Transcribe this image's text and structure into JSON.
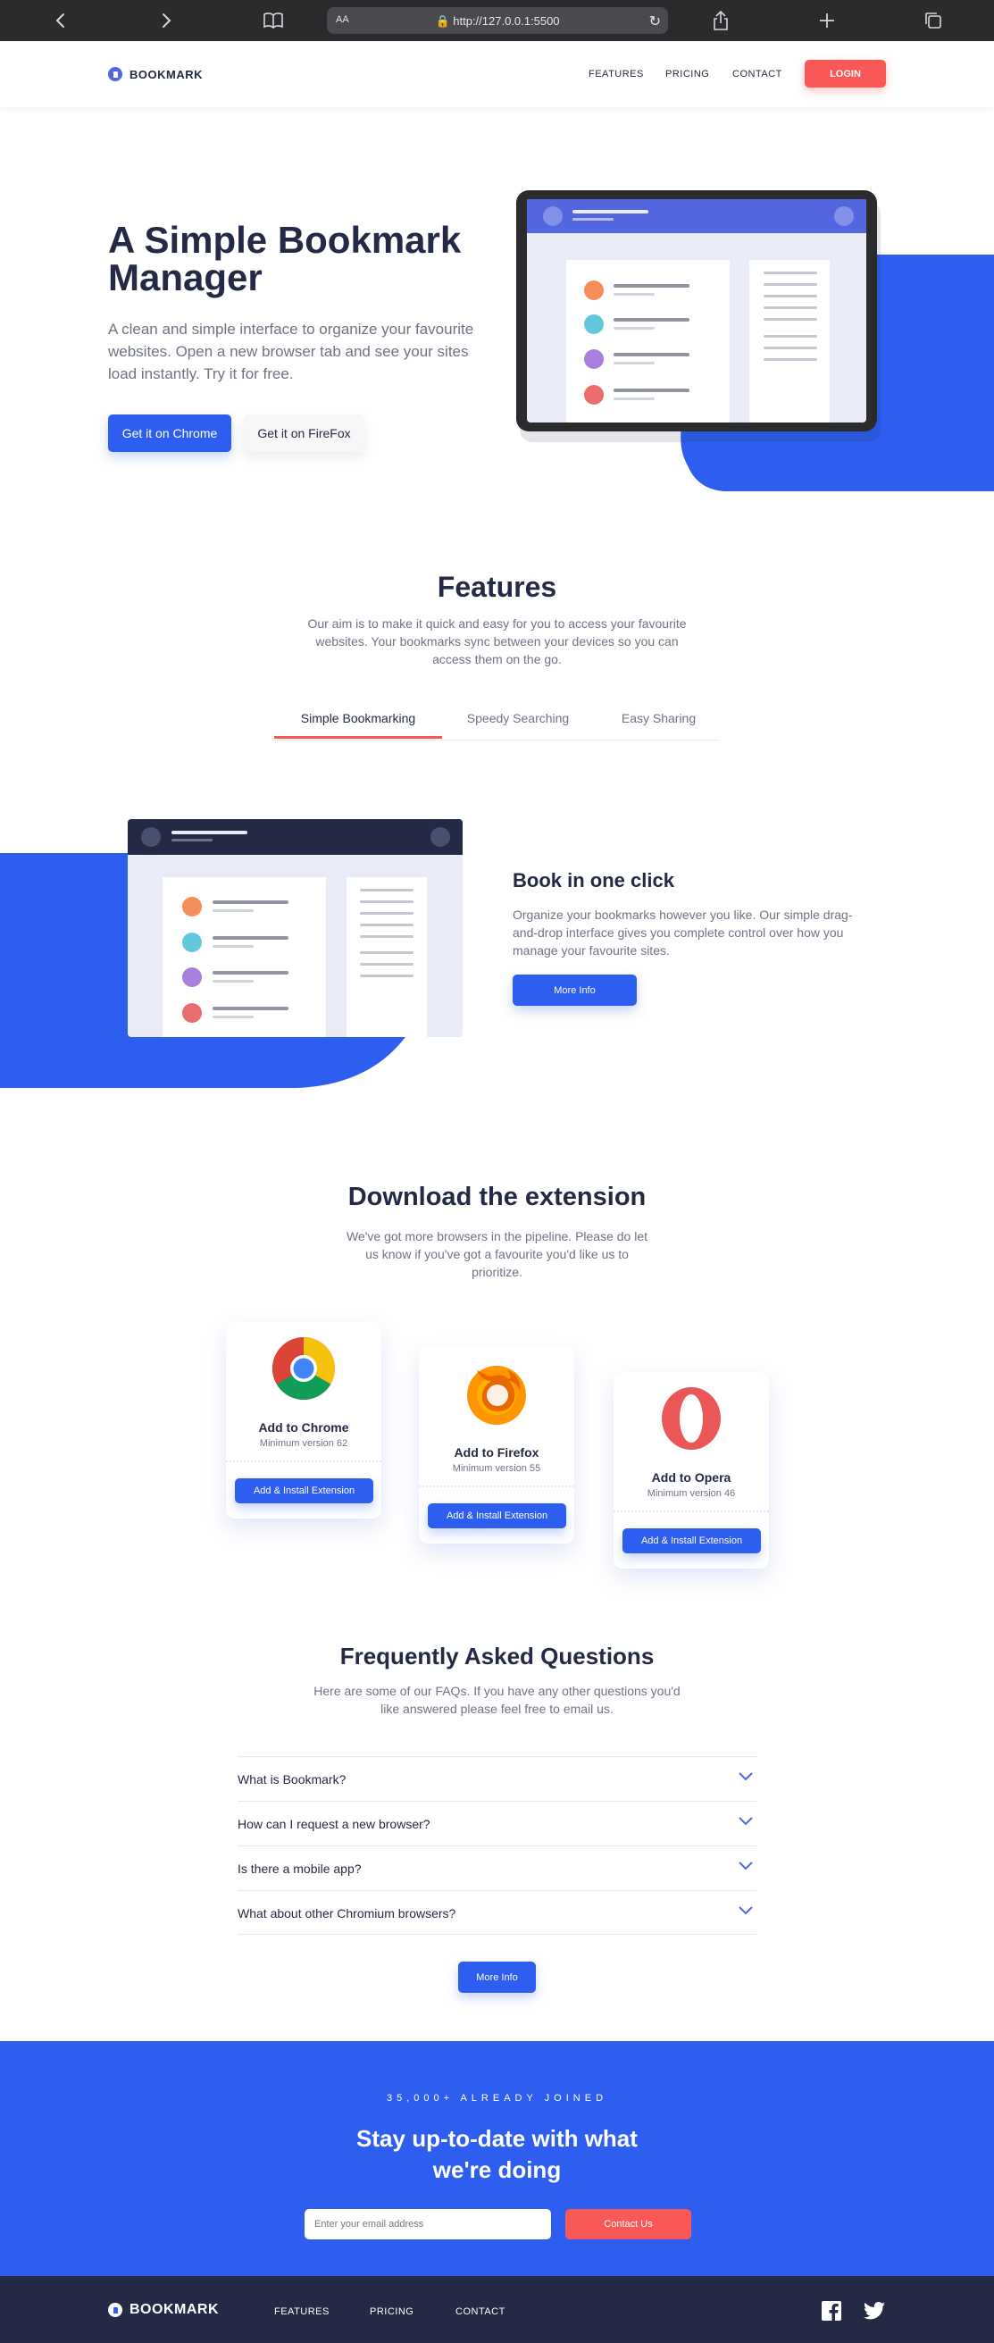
{
  "browser": {
    "url": "http://127.0.0.1:5500",
    "text_size_label": "AA"
  },
  "header": {
    "logo_text": "BOOKMARK",
    "nav": [
      "FEATURES",
      "PRICING",
      "CONTACT"
    ],
    "login": "LOGIN"
  },
  "hero": {
    "title": "A Simple Bookmark Manager",
    "text": "A clean and simple interface to organize your favourite websites. Open a new browser tab and see your sites load instantly. Try it for free.",
    "btn_chrome": "Get it on Chrome",
    "btn_firefox": "Get it on FireFox"
  },
  "features": {
    "title": "Features",
    "text": "Our aim is to make it quick and easy for you to access your favourite websites. Your bookmarks sync between your devices so you can access them on the go.",
    "tabs": [
      "Simple Bookmarking",
      "Speedy Searching",
      "Easy Sharing"
    ],
    "active_tab": "Simple Bookmarking",
    "panel_title": "Book in one click",
    "panel_text": "Organize your bookmarks however you like. Our simple drag-and-drop interface gives you complete control over how you manage your favourite sites.",
    "panel_button": "More Info"
  },
  "download": {
    "title": "Download the extension",
    "text": "We've got more browsers in the pipeline. Please do let us know if you've got a favourite you'd like us to prioritize.",
    "cards": [
      {
        "name": "Add to Chrome",
        "version": "Minimum version 62",
        "button": "Add & Install Extension"
      },
      {
        "name": "Add to Firefox",
        "version": "Minimum version 55",
        "button": "Add & Install Extension"
      },
      {
        "name": "Add to Opera",
        "version": "Minimum version 46",
        "button": "Add & Install Extension"
      }
    ]
  },
  "faq": {
    "title": "Frequently Asked Questions",
    "text": "Here are some of our FAQs. If you have any other questions you'd like answered please feel free to email us.",
    "questions": [
      "What is Bookmark?",
      "How can I request a new browser?",
      "Is there a mobile app?",
      "What about other Chromium browsers?"
    ],
    "button": "More Info"
  },
  "cta": {
    "eyebrow": "35,000+ ALREADY JOINED",
    "title_line1": "Stay up-to-date with what",
    "title_line2": "we're doing",
    "email_placeholder": "Enter your email address",
    "button": "Contact Us"
  },
  "footer": {
    "logo_text": "BOOKMARK",
    "nav": [
      "FEATURES",
      "PRICING",
      "CONTACT"
    ]
  },
  "colors": {
    "primary_blue": "#2D5EF0",
    "soft_red": "#FA5757",
    "dark_navy": "#242A45",
    "grey_text": "#6E7385"
  }
}
